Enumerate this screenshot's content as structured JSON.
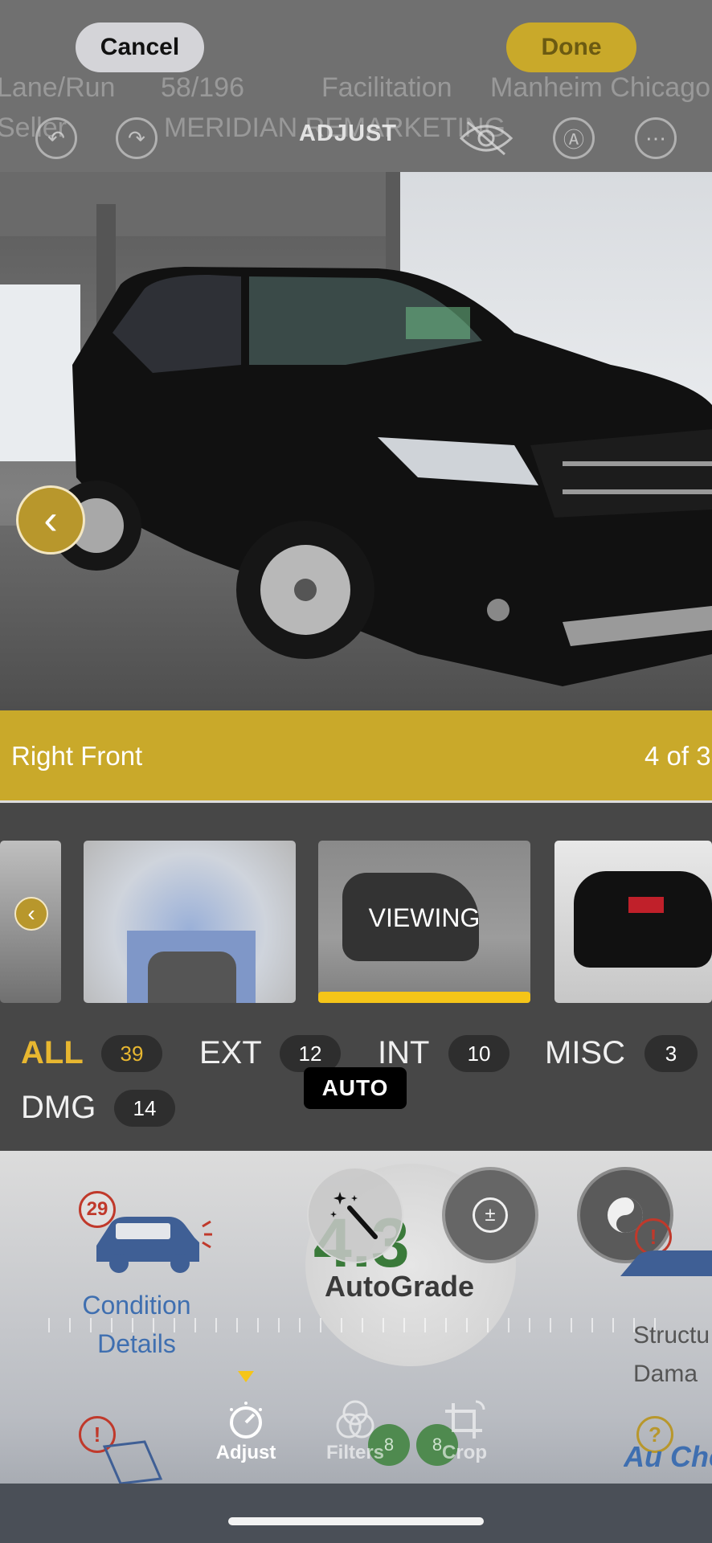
{
  "toolbar": {
    "cancel_label": "Cancel",
    "done_label": "Done",
    "mode_label": "ADJUST",
    "accent": "#c9a92a"
  },
  "background_text": {
    "row1_label": "Lane/Run",
    "row1_value": "58/196",
    "row1_label2": "Facilitation",
    "row1_value2": "Manheim Chicago",
    "row2_label": "Seller",
    "row2_value": "MERIDIAN REMARKETING"
  },
  "photo": {
    "caption": "Right Front",
    "counter": "4 of 3"
  },
  "thumbnails": {
    "viewing_label": "VIEWING"
  },
  "categories": [
    {
      "label": "ALL",
      "count": "39"
    },
    {
      "label": "EXT",
      "count": "12"
    },
    {
      "label": "INT",
      "count": "10"
    },
    {
      "label": "MISC",
      "count": "3"
    },
    {
      "label": "DMG",
      "count": "14"
    }
  ],
  "auto_label": "AUTO",
  "condition": {
    "badge": "29",
    "line1": "Condition",
    "line2": "Details"
  },
  "grade": {
    "score": "4.3",
    "brand": "AutoGrade"
  },
  "structural": {
    "line1": "Structu",
    "line2": "Dama"
  },
  "autocheck": "Au Che",
  "ghost_numbers": [
    "8",
    "8"
  ],
  "tabs": [
    {
      "label": "Adjust",
      "icon": "dial-icon"
    },
    {
      "label": "Filters",
      "icon": "filters-icon"
    },
    {
      "label": "Crop",
      "icon": "crop-icon"
    }
  ]
}
